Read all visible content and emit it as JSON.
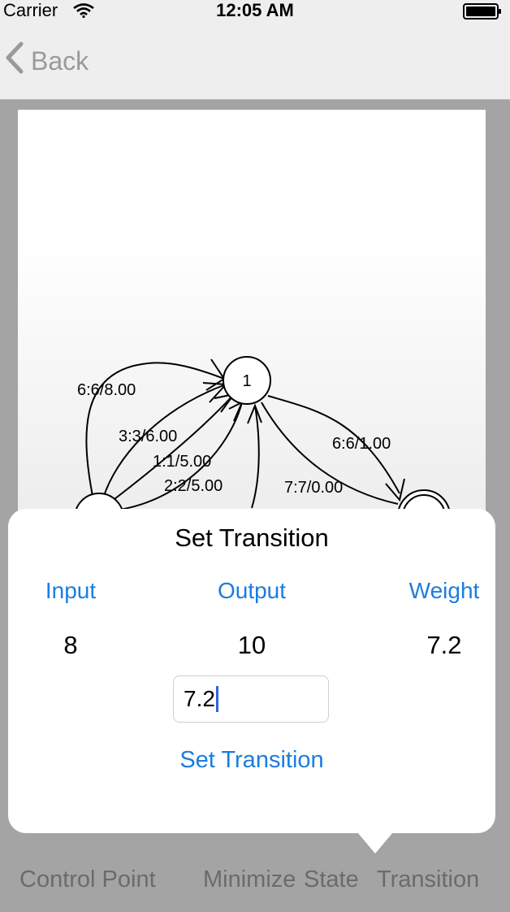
{
  "status_bar": {
    "carrier": "Carrier",
    "time": "12:05 AM",
    "wifi_icon": "wifi-icon",
    "battery_icon": "battery-icon"
  },
  "nav": {
    "back_label": "Back",
    "back_icon": "chevron-left-icon"
  },
  "graph": {
    "nodes": [
      {
        "id": "state-1",
        "label": "1"
      }
    ],
    "edges": [
      {
        "label": "6:6/8.00"
      },
      {
        "label": "3:3/6.00"
      },
      {
        "label": "1:1/5.00"
      },
      {
        "label": "2:2/5.00"
      },
      {
        "label": "6:6/1.00"
      },
      {
        "label": "7:7/0.00"
      }
    ]
  },
  "popover": {
    "title": "Set Transition",
    "columns": [
      {
        "header": "Input",
        "value": "8"
      },
      {
        "header": "Output",
        "value": "10"
      },
      {
        "header": "Weight",
        "value": "7.2"
      }
    ],
    "field_value": "7.2",
    "action_label": "Set Transition"
  },
  "toolbar": {
    "items": [
      {
        "label": "Control Point"
      },
      {
        "label": "Minimize"
      },
      {
        "label": "State"
      },
      {
        "label": "Transition"
      }
    ]
  },
  "colors": {
    "accent": "#1a7de0",
    "nav_background": "#eeeeee",
    "dim_background": "#a4a4a4",
    "caret": "#2f64d9"
  }
}
